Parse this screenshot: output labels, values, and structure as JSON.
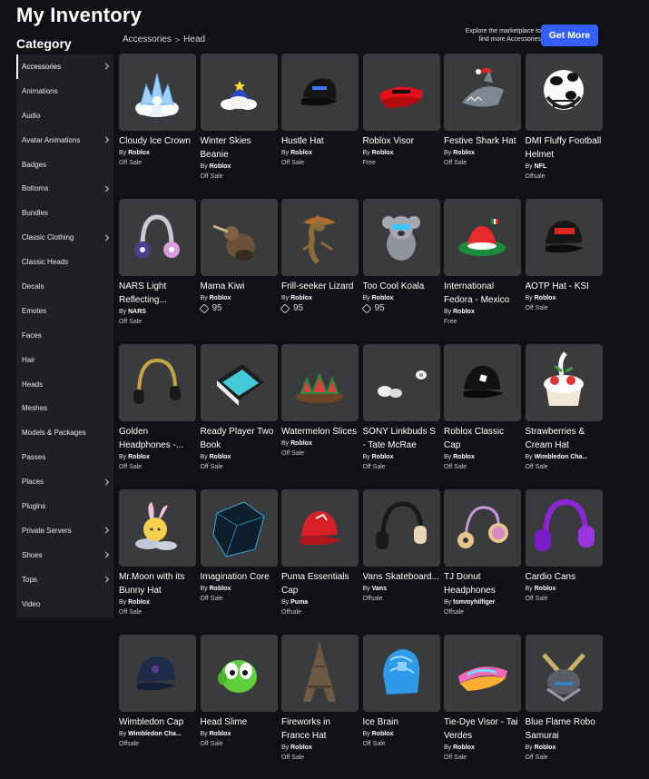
{
  "page_title": "My Inventory",
  "category_heading": "Category",
  "breadcrumb": {
    "parent": "Accessories",
    "current": "Head"
  },
  "promo": {
    "text": "Explore the marketplace to find more Accessories",
    "button": "Get More",
    "accent": "#335fff"
  },
  "sidebar": {
    "items": [
      {
        "label": "Accessories",
        "chevron": true,
        "active": true
      },
      {
        "label": "Animations",
        "chevron": false
      },
      {
        "label": "Audio",
        "chevron": false
      },
      {
        "label": "Avatar Animations",
        "chevron": true
      },
      {
        "label": "Badges",
        "chevron": false
      },
      {
        "label": "Bottoms",
        "chevron": true
      },
      {
        "label": "Bundles",
        "chevron": false
      },
      {
        "label": "Classic Clothing",
        "chevron": true
      },
      {
        "label": "Classic Heads",
        "chevron": false
      },
      {
        "label": "Decals",
        "chevron": false
      },
      {
        "label": "Emotes",
        "chevron": false
      },
      {
        "label": "Faces",
        "chevron": false
      },
      {
        "label": "Hair",
        "chevron": false
      },
      {
        "label": "Heads",
        "chevron": false
      },
      {
        "label": "Meshes",
        "chevron": false
      },
      {
        "label": "Models & Packages",
        "chevron": false
      },
      {
        "label": "Passes",
        "chevron": false
      },
      {
        "label": "Places",
        "chevron": true
      },
      {
        "label": "Plugins",
        "chevron": false
      },
      {
        "label": "Private Servers",
        "chevron": true
      },
      {
        "label": "Shoes",
        "chevron": true
      },
      {
        "label": "Tops",
        "chevron": true
      },
      {
        "label": "Video",
        "chevron": false
      }
    ]
  },
  "items": [
    {
      "name": "Cloudy Ice Crown",
      "by": "By",
      "creator": "Roblox",
      "price": "Off Sale",
      "icon": "ice-crown-icon"
    },
    {
      "name": "Winter Skies Beanie",
      "by": "By",
      "creator": "Roblox",
      "price": "Off Sale",
      "icon": "cloud-beanie-icon"
    },
    {
      "name": "Hustle Hat",
      "by": "By",
      "creator": "Roblox",
      "price": "Off Sale",
      "icon": "black-cap-icon"
    },
    {
      "name": "Roblox Visor",
      "by": "By",
      "creator": "Roblox",
      "price": "Free",
      "icon": "red-visor-icon"
    },
    {
      "name": "Festive Shark Hat",
      "by": "By",
      "creator": "Roblox",
      "price": "Off Sale",
      "icon": "shark-hat-icon"
    },
    {
      "name": "DMI Fluffy Football Helmet",
      "by": "By",
      "creator": "NFL",
      "price": "Offsale",
      "icon": "football-helmet-icon"
    },
    {
      "name": "NARS Light Reflecting...",
      "by": "By",
      "creator": "NARS",
      "price": "Off Sale",
      "icon": "flower-headphones-icon"
    },
    {
      "name": "Mama Kiwi",
      "by": "By",
      "creator": "Roblox",
      "price": "95",
      "robux": true,
      "icon": "kiwi-bird-icon"
    },
    {
      "name": "Frill-seeker Lizard",
      "by": "By",
      "creator": "Roblox",
      "price": "95",
      "robux": true,
      "icon": "lizard-icon"
    },
    {
      "name": "Too Cool Koala",
      "by": "By",
      "creator": "Roblox",
      "price": "95",
      "robux": true,
      "icon": "koala-icon"
    },
    {
      "name": "International Fedora - Mexico",
      "by": "By",
      "creator": "Roblox",
      "price": "Free",
      "icon": "mexico-fedora-icon"
    },
    {
      "name": "AOTP Hat - KSI",
      "by": "By",
      "creator": "Roblox",
      "price": "Off Sale",
      "icon": "aotp-cap-icon"
    },
    {
      "name": "Golden Headphones -...",
      "by": "By",
      "creator": "Roblox",
      "price": "Off Sale",
      "icon": "golden-headphones-icon"
    },
    {
      "name": "Ready Player Two Book",
      "by": "By",
      "creator": "Roblox",
      "price": "Off Sale",
      "icon": "book-icon"
    },
    {
      "name": "Watermelon Slices",
      "by": "By",
      "creator": "Roblox",
      "price": "Off Sale",
      "icon": "watermelon-icon"
    },
    {
      "name": "SONY Linkbuds S - Tate McRae",
      "by": "By",
      "creator": "Roblox",
      "price": "Off Sale",
      "icon": "earbuds-icon"
    },
    {
      "name": "Roblox Classic Cap",
      "by": "By",
      "creator": "Roblox",
      "price": "Off Sale",
      "icon": "classic-cap-icon"
    },
    {
      "name": "Strawberries & Cream Hat",
      "by": "By",
      "creator": "Wimbledon Cha...",
      "price": "Off Sale",
      "icon": "strawberry-cream-icon"
    },
    {
      "name": "Mr.Moon with its Bunny Hat",
      "by": "By",
      "creator": "Roblox",
      "price": "Off Sale",
      "icon": "moon-bunny-icon"
    },
    {
      "name": "Imagination Core",
      "by": "By",
      "creator": "Roblox",
      "price": "Off Sale",
      "icon": "cube-icon"
    },
    {
      "name": "Puma Essentials Cap",
      "by": "By",
      "creator": "Puma",
      "price": "Offsale",
      "icon": "red-cap-icon"
    },
    {
      "name": "Vans Skateboard...",
      "by": "By",
      "creator": "Vans",
      "price": "Offsale",
      "icon": "vans-headphones-icon"
    },
    {
      "name": "TJ Donut Headphones",
      "by": "By",
      "creator": "tommyhilfiger",
      "price": "Offsale",
      "icon": "donut-headphones-icon"
    },
    {
      "name": "Cardio Cans",
      "by": "By",
      "creator": "Roblox",
      "price": "Off Sale",
      "icon": "purple-headphones-icon"
    },
    {
      "name": "Wimbledon Cap",
      "by": "By",
      "creator": "Wimbledon Cha...",
      "price": "Offsale",
      "icon": "navy-cap-icon"
    },
    {
      "name": "Head Slime",
      "by": "By",
      "creator": "Roblox",
      "price": "Off Sale",
      "icon": "slime-icon"
    },
    {
      "name": "Fireworks in France Hat",
      "by": "By",
      "creator": "Roblox",
      "price": "Off Sale",
      "icon": "eiffel-tower-icon"
    },
    {
      "name": "Ice Brain",
      "by": "By",
      "creator": "Roblox",
      "price": "Off Sale",
      "icon": "ice-brain-icon"
    },
    {
      "name": "Tie-Dye Visor - Tai Verdes",
      "by": "By",
      "creator": "Roblox",
      "price": "Off Sale",
      "icon": "tiedye-visor-icon"
    },
    {
      "name": "Blue Flame Robo Samurai",
      "by": "By",
      "creator": "Roblox",
      "price": "Off Sale",
      "icon": "samurai-helmet-icon"
    }
  ]
}
